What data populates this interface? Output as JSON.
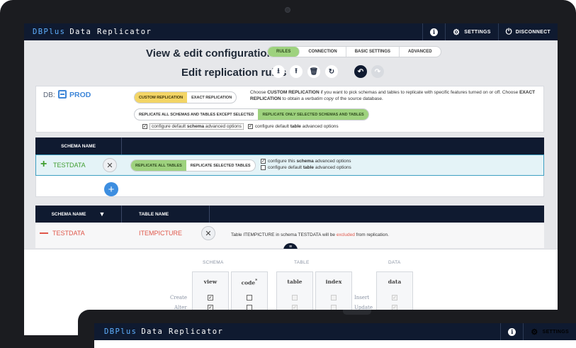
{
  "app": {
    "brand_1": "DBPlus",
    "brand_2": "Data Replicator",
    "settings": "SETTINGS",
    "disconnect": "DISCONNECT",
    "info": "i"
  },
  "header": {
    "view_title": "View & edit configuration",
    "tabs": [
      "RULES",
      "CONNECTION",
      "BASIC SETTINGS",
      "ADVANCED"
    ],
    "edit_title": "Edit replication rules"
  },
  "db": {
    "label": "DB:",
    "name": "PROD",
    "mode_options": [
      "CUSTOM REPLICATION",
      "EXACT REPLICATION"
    ],
    "note_parts": {
      "p1": "Choose ",
      "b1": "CUSTOM REPLICATION",
      "p2": " if you want to pick schemas and tables to replicate with specific features turned on or off. Choose ",
      "b2": "EXACT REPLICATION",
      "p3": " to obtain a ",
      "i1": "verbatim copy",
      "p4": " of the source database."
    },
    "scope_options": [
      "REPLICATE ALL SCHEMAS AND TABLES EXCEPT SELECTED",
      "REPLICATE ONLY SELECTED SCHEMAS AND TABLES"
    ],
    "opt1_a": "configure default ",
    "opt1_b": "schema",
    "opt1_c": " advanced options",
    "opt2_a": "configure default ",
    "opt2_b": "table",
    "opt2_c": " advanced options"
  },
  "schema_table": {
    "header": "SCHEMA NAME",
    "row_name": "TESTDATA",
    "table_options": [
      "REPLICATE ALL TABLES",
      "REPLICATE SELECTED TABLES"
    ],
    "cfg1_a": "configure this ",
    "cfg1_b": "schema",
    "cfg1_c": " advanced options",
    "cfg2_a": "configure default ",
    "cfg2_b": "table",
    "cfg2_c": " advanced options"
  },
  "excluded_table": {
    "h_schema": "SCHEMA NAME",
    "h_table": "TABLE NAME",
    "schema": "TESTDATA",
    "table": "ITEMPICTURE",
    "note_a": "Table ITEMPICTURE in schema TESTDATA will be ",
    "note_ex": "excluded",
    "note_b": " from replication."
  },
  "options": {
    "groups": [
      "SCHEMA",
      "TABLE",
      "DATA"
    ],
    "columns": [
      "view",
      "code",
      "table",
      "index",
      "data"
    ],
    "code_mark": "*",
    "rows_left": [
      "Create",
      "Alter"
    ],
    "rows_right": [
      "Insert",
      "Update"
    ]
  },
  "colors": {
    "navy": "#0f1a30",
    "green": "#9ed27e",
    "yellow": "#f3d566",
    "blue": "#3d8ee0",
    "red": "#e0574a"
  }
}
